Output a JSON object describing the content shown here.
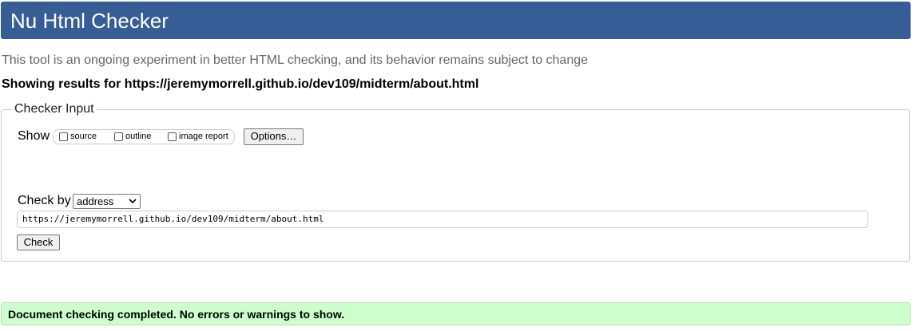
{
  "header": {
    "title": "Nu Html Checker"
  },
  "intro_text": "This tool is an ongoing experiment in better HTML checking, and its behavior remains subject to change",
  "results_heading": "Showing results for https://jeremymorrell.github.io/dev109/midterm/about.html",
  "checker_input": {
    "legend": "Checker Input",
    "show_label": "Show",
    "show_options": [
      {
        "label": "source",
        "checked": false
      },
      {
        "label": "outline",
        "checked": false
      },
      {
        "label": "image report",
        "checked": false
      }
    ],
    "options_button": "Options…",
    "check_by_label": "Check by",
    "check_by_selected": "address",
    "url_value": "https://jeremymorrell.github.io/dev109/midterm/about.html",
    "check_button": "Check"
  },
  "status": {
    "message": "Document checking completed. No errors or warnings to show.",
    "color": "#ccffcc"
  },
  "colors": {
    "header_bg": "#365d95",
    "header_text": "#ffffff",
    "intro_text": "#666666"
  }
}
